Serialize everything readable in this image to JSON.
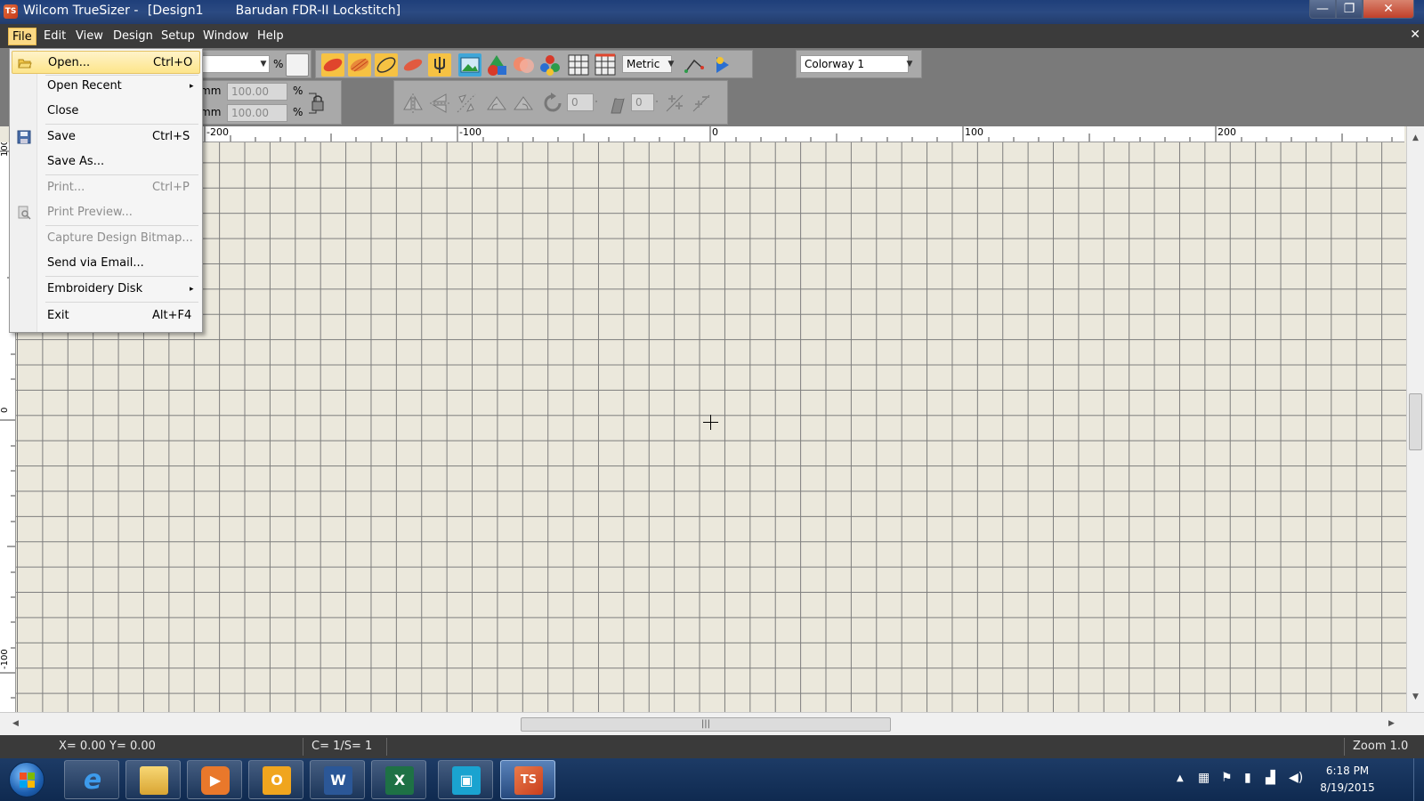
{
  "window": {
    "app_name": "Wilcom TrueSizer",
    "document": "[Design1",
    "machine": "Barudan FDR-II Lockstitch]",
    "icon_text": "TS",
    "controls": {
      "minimize": "—",
      "maximize": "❐",
      "close": "✕"
    }
  },
  "menubar": {
    "items": [
      "File",
      "Edit",
      "View",
      "Design",
      "Setup",
      "Window",
      "Help"
    ],
    "active": "File",
    "mdi_close": "✕"
  },
  "file_menu": {
    "items": [
      {
        "label": "Open...",
        "shortcut": "Ctrl+O",
        "icon": "open-folder-icon"
      },
      {
        "label": "Open Recent",
        "submenu": "▸"
      },
      {
        "label": "Close"
      },
      {
        "label": "Save",
        "shortcut": "Ctrl+S",
        "icon": "save-disk-icon"
      },
      {
        "label": "Save As..."
      },
      {
        "label": "Print...",
        "shortcut": "Ctrl+P"
      },
      {
        "label": "Print Preview...",
        "icon": "print-preview-icon"
      },
      {
        "label": "Capture Design Bitmap..."
      },
      {
        "label": "Send via Email..."
      },
      {
        "label": "Embroidery Disk",
        "submenu": "▸"
      },
      {
        "label": "Exit",
        "shortcut": "Alt+F4"
      }
    ]
  },
  "toolbar": {
    "percent_sign": "%",
    "units": "Metric",
    "colorway": "Colorway 1",
    "width_unit": "mm",
    "height_unit": "mm",
    "width_percent": "100.00",
    "height_percent": "100.00",
    "rotate_value": "0",
    "slant_value": "0"
  },
  "rulers": {
    "top": [
      "-200",
      "-100",
      "0",
      "100",
      "200"
    ],
    "left": [
      "100",
      "0",
      "-100"
    ]
  },
  "status": {
    "coords": "X=   0.00 Y=   0.00",
    "colors_stops": "C=  1/S=  1",
    "zoom": "Zoom 1.0"
  },
  "taskbar": {
    "apps": [
      {
        "name": "internet-explorer",
        "glyph": "e"
      },
      {
        "name": "file-explorer",
        "glyph": ""
      },
      {
        "name": "media-player",
        "glyph": "▶"
      },
      {
        "name": "outlook",
        "glyph": "O"
      },
      {
        "name": "word",
        "glyph": "W"
      },
      {
        "name": "excel",
        "glyph": "X"
      },
      {
        "name": "photo-app",
        "glyph": "▣"
      },
      {
        "name": "truesizer",
        "glyph": "TS"
      }
    ],
    "time": "6:18 PM",
    "date": "8/19/2015"
  },
  "colors": {
    "menu_highlight": "#fde58a",
    "canvas_bg": "#ebe8dc",
    "grid_line": "#7d7d7d",
    "status_bg": "#3a3a3a"
  }
}
